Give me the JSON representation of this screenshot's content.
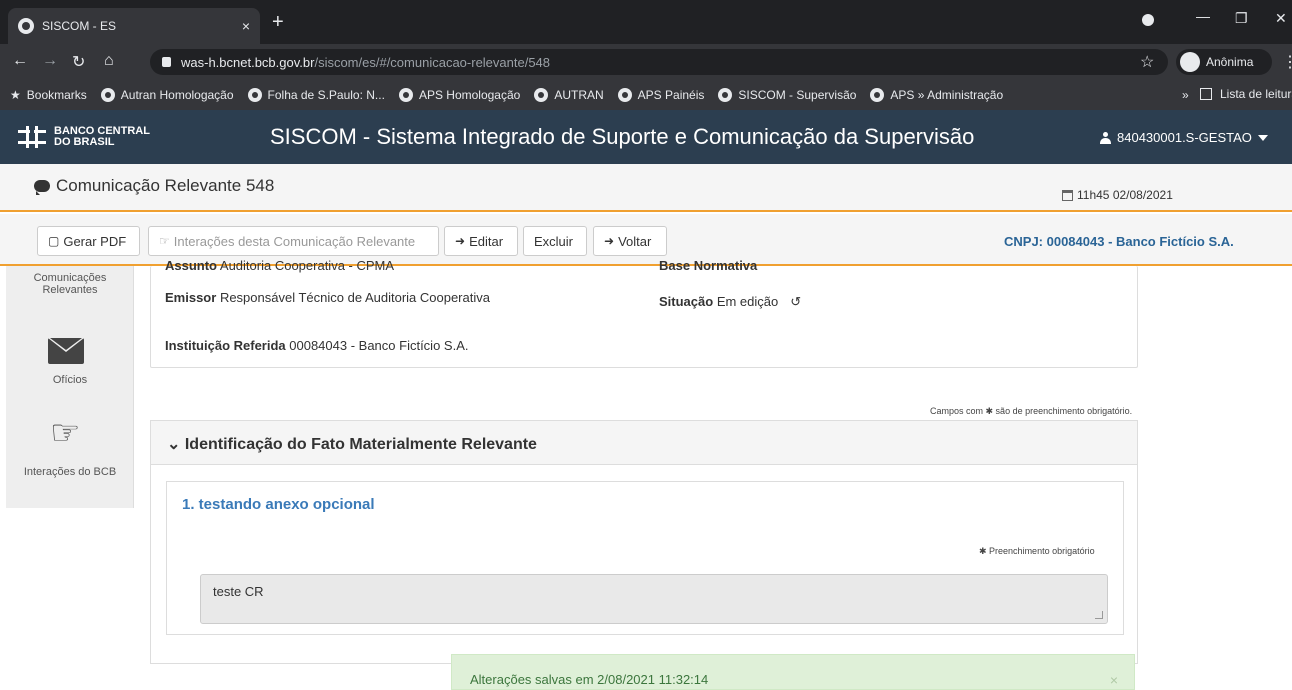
{
  "browser": {
    "tab_title": "SISCOM - ES",
    "tab_close": "×",
    "new_tab": "+",
    "url_host": "was-h.bcnet.bcb.gov.br",
    "url_path": "/siscom/es/#/comunicacao-relevante/548",
    "profile_label": "Anônima",
    "bookmarks": [
      "Bookmarks",
      "Autran Homologação",
      "Folha de S.Paulo: N...",
      "APS Homologação",
      "AUTRAN",
      "APS Painéis",
      "SISCOM - Supervisão",
      "APS » Administração"
    ],
    "bookmarks_more": "»",
    "reading_list": "Lista de leitura"
  },
  "app": {
    "logo_line1": "BANCO CENTRAL",
    "logo_line2": "DO BRASIL",
    "title": "SISCOM - Sistema Integrado de Suporte e Comunicação da Supervisão",
    "user": "840430001.S-GESTAO"
  },
  "page": {
    "title": "Comunicação Relevante 548",
    "datetime": "11h45 02/08/2021"
  },
  "toolbar": {
    "pdf": "Gerar PDF",
    "interactions": "Interações desta Comunicação Relevante",
    "edit": "Editar",
    "delete": "Excluir",
    "back": "Voltar",
    "cnpj": "CNPJ: 00084043 - Banco Fictício S.A."
  },
  "sidebar": {
    "items": [
      "Comunicações Relevantes",
      "Ofícios",
      "Interações do BCB"
    ]
  },
  "details": {
    "assunto_label": "Assunto",
    "assunto_value": "Auditoria Cooperativa - CPMA",
    "base_label": "Base Normativa",
    "emissor_label": "Emissor",
    "emissor_value": "Responsável Técnico de Auditoria Cooperativa",
    "situacao_label": "Situação",
    "situacao_value": "Em edição",
    "instituicao_label": "Instituição Referida",
    "instituicao_value": "00084043 - Banco Fictício S.A."
  },
  "form": {
    "required_note": "Campos com ✱ são de preenchimento obrigatório.",
    "section_title": "Identificação do Fato Materialmente Relevante",
    "item_title": "1.  testando anexo opcional",
    "required_field": "✱ Preenchimento obrigatório",
    "answer_value": "teste CR"
  },
  "toast": {
    "message": "Alterações salvas em 2/08/2021 11:32:14",
    "close": "×"
  },
  "colors": {
    "header_bg": "#2c3e50",
    "accent_orange": "#f0a030",
    "link_blue": "#2a6496",
    "toast_bg": "#dff0d8"
  }
}
